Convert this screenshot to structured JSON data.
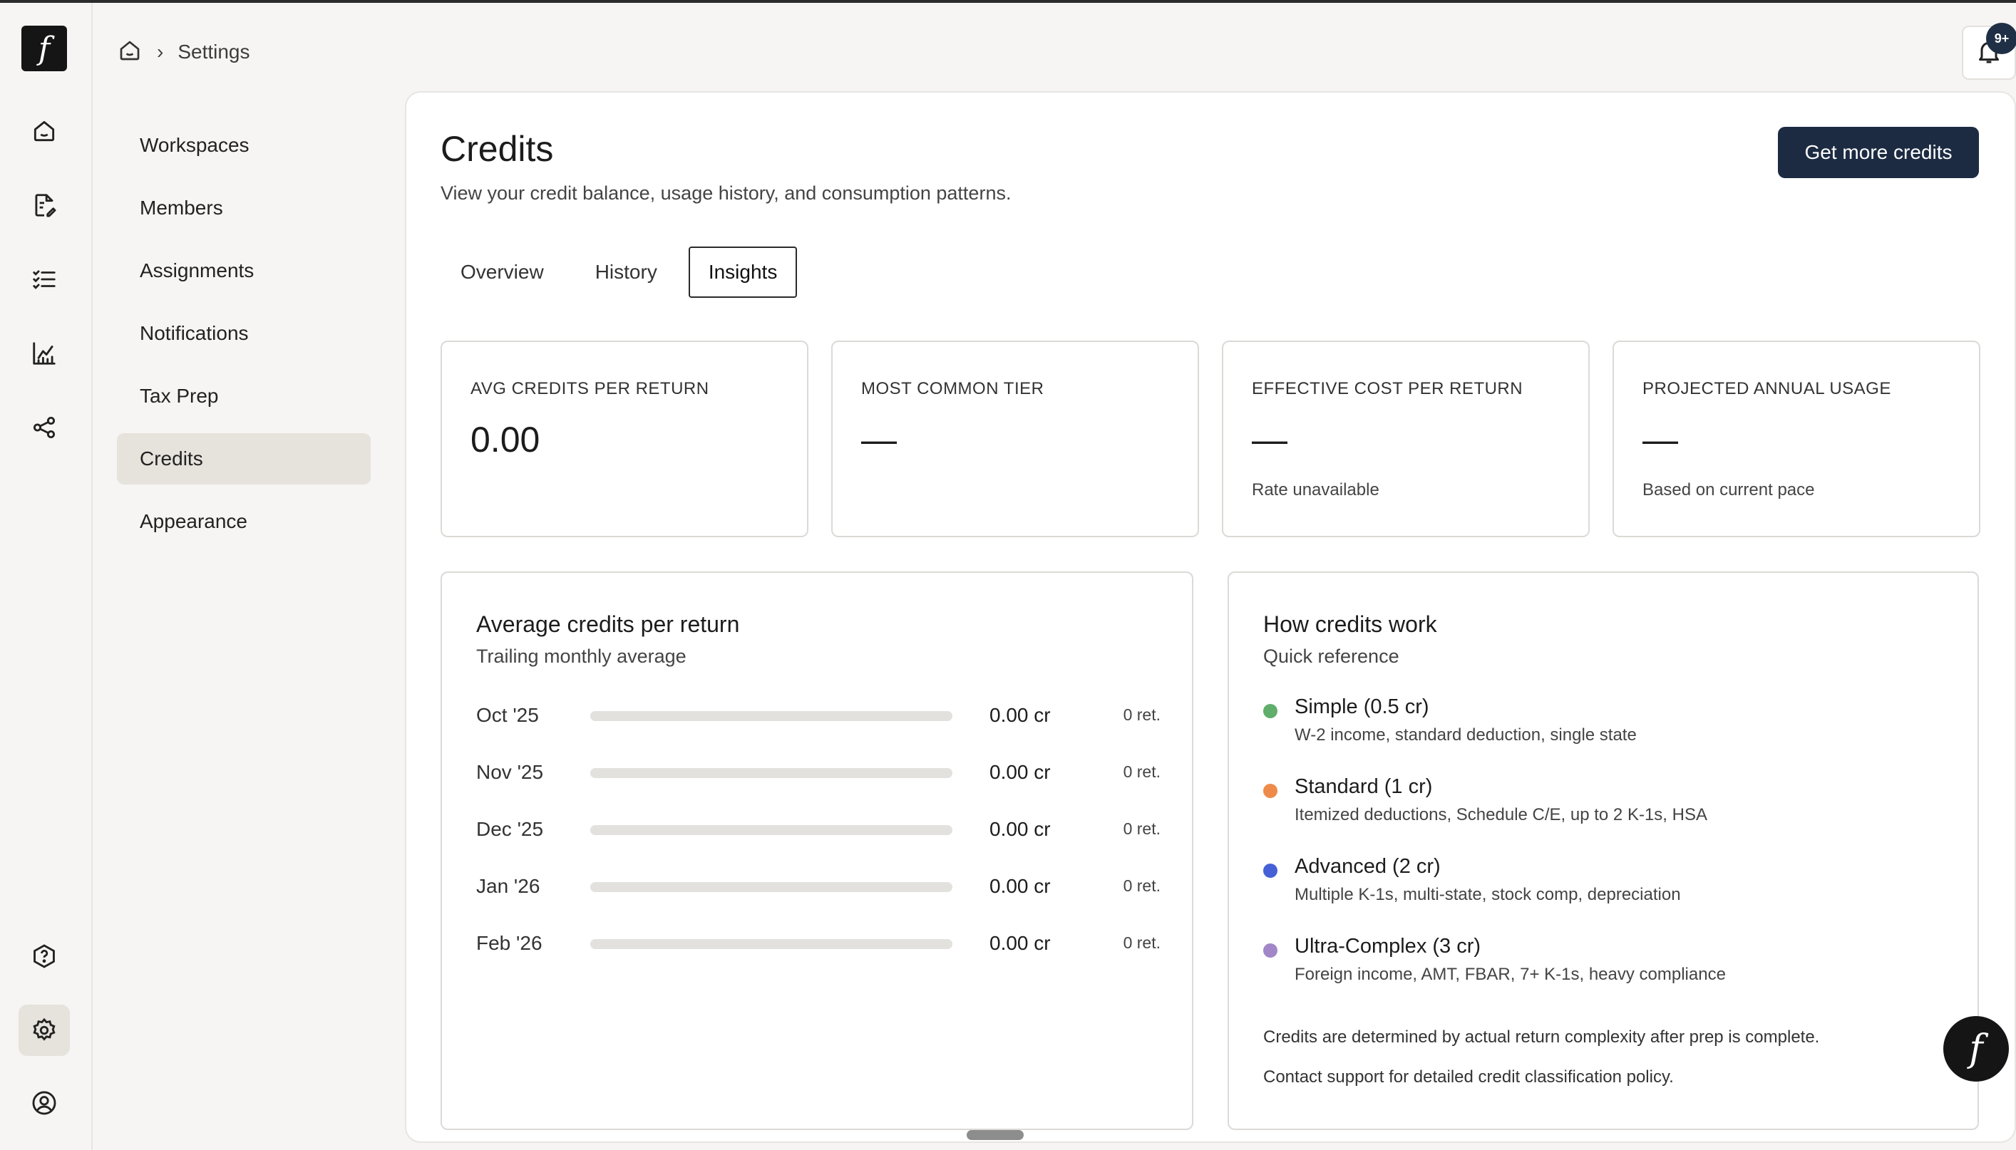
{
  "app": {
    "logo_glyph": "f"
  },
  "rail": {
    "icons": [
      "home-icon",
      "document-edit-icon",
      "checklist-icon",
      "chart-icon",
      "share-icon",
      "help-icon",
      "settings-icon",
      "account-icon"
    ],
    "active": "settings-icon"
  },
  "breadcrumb": {
    "page": "Settings"
  },
  "notifications": {
    "badge": "9+"
  },
  "settings_nav": {
    "items": [
      "Workspaces",
      "Members",
      "Assignments",
      "Notifications",
      "Tax Prep",
      "Credits",
      "Appearance"
    ],
    "active": "Credits"
  },
  "page": {
    "title": "Credits",
    "subtitle": "View your credit balance, usage history, and consumption patterns.",
    "cta": "Get more credits"
  },
  "tabs": {
    "items": [
      "Overview",
      "History",
      "Insights"
    ],
    "active": "Insights"
  },
  "stats": [
    {
      "label": "AVG CREDITS PER RETURN",
      "value": "0.00",
      "note": ""
    },
    {
      "label": "MOST COMMON TIER",
      "value": "—",
      "note": ""
    },
    {
      "label": "EFFECTIVE COST PER RETURN",
      "value": "—",
      "note": "Rate unavailable"
    },
    {
      "label": "PROJECTED ANNUAL USAGE",
      "value": "—",
      "note": "Based on current pace"
    }
  ],
  "usage_card": {
    "title": "Average credits per return",
    "subtitle": "Trailing monthly average",
    "rows": [
      {
        "month": "Oct '25",
        "credits": "0.00 cr",
        "returns": "0 ret.",
        "fill": 0
      },
      {
        "month": "Nov '25",
        "credits": "0.00 cr",
        "returns": "0 ret.",
        "fill": 0
      },
      {
        "month": "Dec '25",
        "credits": "0.00 cr",
        "returns": "0 ret.",
        "fill": 0
      },
      {
        "month": "Jan '26",
        "credits": "0.00 cr",
        "returns": "0 ret.",
        "fill": 0
      },
      {
        "month": "Feb '26",
        "credits": "0.00 cr",
        "returns": "0 ret.",
        "fill": 0
      }
    ]
  },
  "how_card": {
    "title": "How credits work",
    "subtitle": "Quick reference",
    "tiers": [
      {
        "name": "Simple (0.5 cr)",
        "desc": "W-2 income, standard deduction, single state",
        "color": "#5fae6b"
      },
      {
        "name": "Standard (1 cr)",
        "desc": "Itemized deductions, Schedule C/E, up to 2 K-1s, HSA",
        "color": "#ee8a4a"
      },
      {
        "name": "Advanced (2 cr)",
        "desc": "Multiple K-1s, multi-state, stock comp, depreciation",
        "color": "#4661d6"
      },
      {
        "name": "Ultra-Complex (3 cr)",
        "desc": "Foreign income, AMT, FBAR, 7+ K-1s, heavy compliance",
        "color": "#a287c8"
      }
    ],
    "footnote": "Credits are determined by actual return complexity after prep is complete.",
    "support": "Contact support for detailed credit classification policy."
  },
  "fab": {
    "glyph": "f"
  }
}
